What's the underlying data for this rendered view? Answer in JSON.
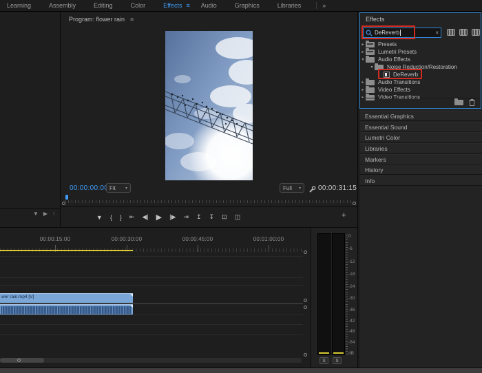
{
  "workspace": {
    "items": [
      "Learning",
      "Assembly",
      "Editing",
      "Color",
      "Effects",
      "Audio",
      "Graphics",
      "Libraries"
    ],
    "active_item": "Effects",
    "active_menu_icon": "≡",
    "overflow_icon": "»"
  },
  "left_panel": {
    "toolbar": {
      "funnel_icon": "▼",
      "play_icon": "▶",
      "export_icon": "↑"
    }
  },
  "program": {
    "title": "Program: flower rain",
    "panel_menu_icon": "≡",
    "current_timecode": "00:00:00:00",
    "zoom_select": "Fit",
    "quality_select": "Full",
    "dropdown_caret": "▾",
    "duration_timecode": "00:00:31:15",
    "transport": {
      "marker": "▼",
      "mark_in": "{",
      "mark_out": "}",
      "go_to_in": "⇤",
      "step_back": "◀|",
      "play": "▶",
      "step_forward": "|▶",
      "go_to_out": "⇥",
      "lift": "↥",
      "extract": "↧",
      "export_frame": "⊡",
      "comparison_view": "◫",
      "button_editor": "+"
    }
  },
  "effects_panel": {
    "title": "Effects",
    "search": {
      "value": "DeReverb",
      "clear_icon": "×"
    },
    "tree": [
      {
        "chevron": "▸",
        "label": "Presets"
      },
      {
        "chevron": "▸",
        "label": "Lumetri Presets"
      },
      {
        "chevron": "▾",
        "label": "Audio Effects"
      },
      {
        "chevron": "▾",
        "label": "Noise Reduction/Restoration"
      },
      {
        "chevron": "",
        "label": "DeReverb"
      },
      {
        "chevron": "▸",
        "label": "Audio Transitions"
      },
      {
        "chevron": "▸",
        "label": "Video Effects"
      },
      {
        "chevron": "▸",
        "label": "Video Transitions"
      }
    ]
  },
  "right_panels": [
    "Essential Graphics",
    "Essential Sound",
    "Lumetri Color",
    "Libraries",
    "Markers",
    "History",
    "Info"
  ],
  "timeline": {
    "ruler_labels": [
      "00:00:15:00",
      "00:00:30:00",
      "00:00:45:00",
      "00:01:00:00"
    ],
    "video_clip_label": "wer rain.mp4 [V]"
  },
  "audio_meter": {
    "scale": [
      "0",
      "-6",
      "-12",
      "-18",
      "-24",
      "-30",
      "-36",
      "-42",
      "-48",
      "-54",
      "dB"
    ],
    "solo_label": "S"
  },
  "colors": {
    "accent_blue": "#2f86d1",
    "annotation_red": "#d02b1f",
    "timecode_blue": "#3f9bf4",
    "clip_blue": "#7aa6d8",
    "work_bar_yellow": "#d9c931"
  }
}
